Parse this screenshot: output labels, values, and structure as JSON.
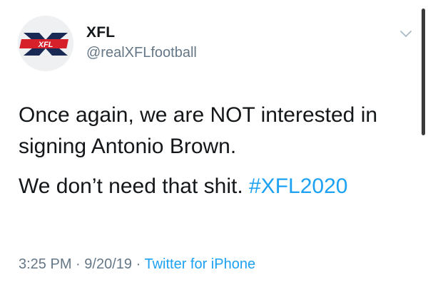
{
  "tweet": {
    "author_name": "XFL",
    "author_handle": "@realXFLfootball",
    "avatar_logo_text": "XFL",
    "text_line1": "Once again, we are NOT interested in signing Antonio Brown.",
    "text_line2": "We don’t need that shit.",
    "hashtag": "#XFL2020",
    "time": "3:25 PM",
    "date": "9/20/19",
    "separator": "·",
    "source": "Twitter for iPhone"
  },
  "colors": {
    "link": "#1da1f2",
    "secondary_text": "#657786",
    "primary_text": "#14171a",
    "logo_red": "#d6202a",
    "logo_navy": "#1b2a55"
  },
  "icons": {
    "avatar": "xfl-logo",
    "caret": "chevron-down-icon"
  }
}
